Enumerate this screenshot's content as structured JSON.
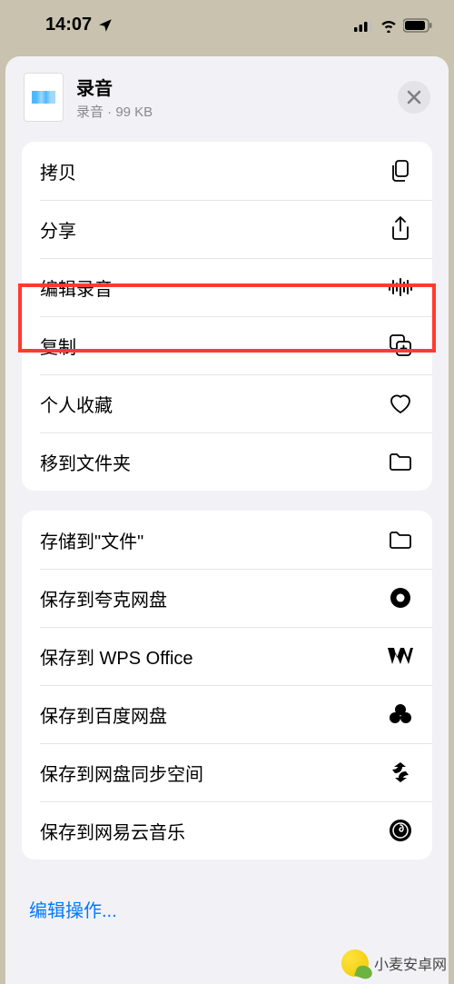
{
  "status": {
    "time": "14:07"
  },
  "file": {
    "name": "录音",
    "meta": "录音 · 99 KB"
  },
  "group1": {
    "copy": "拷贝",
    "share": "分享",
    "edit_recording": "编辑录音",
    "duplicate": "复制",
    "favorite": "个人收藏",
    "move_to_folder": "移到文件夹"
  },
  "group2": {
    "save_to_files": "存储到\"文件\"",
    "save_quark": "保存到夸克网盘",
    "save_wps": "保存到 WPS Office",
    "save_baidu": "保存到百度网盘",
    "save_sync": "保存到网盘同步空间",
    "save_netease": "保存到网易云音乐"
  },
  "edit_actions": "编辑操作...",
  "watermark": "小麦安卓网"
}
